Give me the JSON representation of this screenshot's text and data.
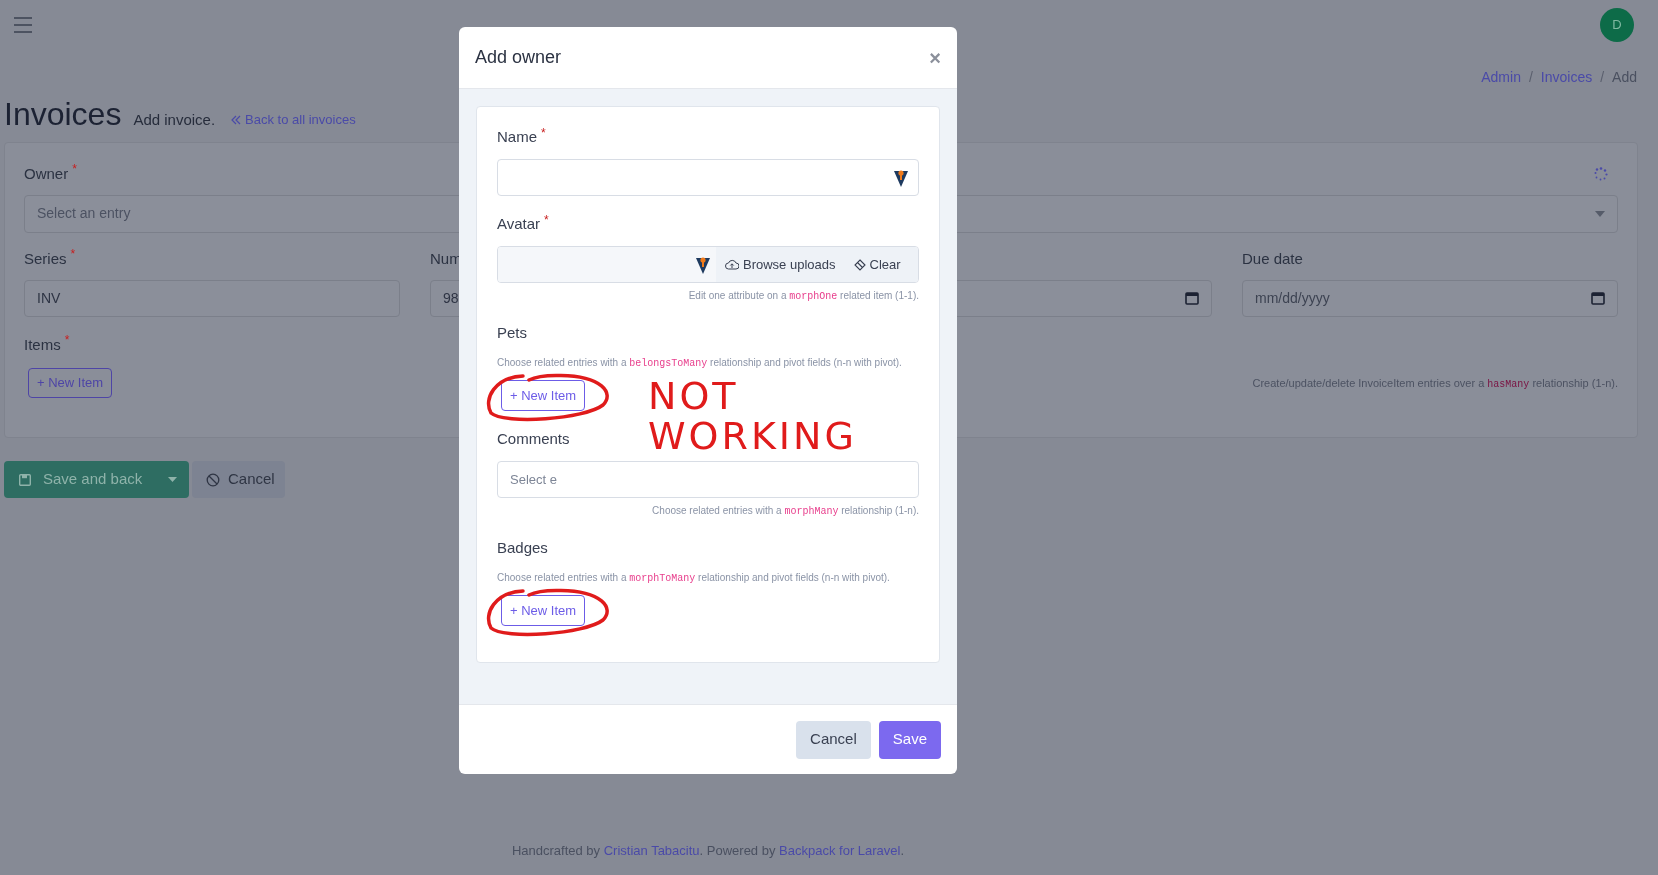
{
  "header": {
    "avatar": "D"
  },
  "breadcrumb": {
    "separator": "/",
    "items": [
      {
        "label": "Admin",
        "link": true
      },
      {
        "label": "Invoices",
        "link": true
      },
      {
        "label": "Add",
        "link": false
      }
    ]
  },
  "page": {
    "title": "Invoices",
    "subtitle": "Add invoice.",
    "back_link": "Back to all invoices"
  },
  "form": {
    "owner": {
      "label": "Owner",
      "mark": "*",
      "placeholder": "Select an entry"
    },
    "fields": [
      {
        "kind": "text",
        "label": "Series",
        "mark": "*",
        "value": "INV"
      },
      {
        "kind": "text",
        "label": "Num",
        "value": "98"
      },
      {
        "kind": "date"
      },
      {
        "kind": "date",
        "label": "Due date",
        "placeholder": "mm/dd/yyyy"
      }
    ],
    "items": {
      "label": "Items",
      "mark": "*",
      "button": "+ New Item",
      "help": {
        "before": "Create/update/delete InvoiceItem entries over a ",
        "code": "hasMany",
        "after": " relationship (1-n)."
      }
    }
  },
  "actions": [
    {
      "kind": "primary",
      "label": "Save and back"
    },
    {
      "kind": "secondary",
      "label": "Cancel"
    }
  ],
  "footer": [
    {
      "text": "Handcrafted by ",
      "link": false
    },
    {
      "text": "Cristian Tabacitu",
      "link": true
    },
    {
      "text": ". Powered by ",
      "link": false
    },
    {
      "text": "Backpack for Laravel",
      "link": true
    },
    {
      "text": ".",
      "link": false
    }
  ],
  "modal": {
    "title": "Add owner",
    "close": "×",
    "fields": [
      {
        "kind": "text",
        "label": "Name",
        "mark": "*"
      },
      {
        "kind": "upload",
        "label": "Avatar",
        "mark": "*",
        "buttons": [
          "Browse uploads",
          "Clear"
        ],
        "help": {
          "before": "Edit one attribute on a ",
          "code": "morphOne",
          "after": " related item (1-1)."
        }
      },
      {
        "kind": "repeatable",
        "label": "Pets",
        "help": {
          "before": "Choose related entries with a ",
          "code": "belongsToMany",
          "after": " relationship and pivot fields (n-n with pivot)."
        },
        "button": "+ New Item",
        "circled": true
      },
      {
        "kind": "select",
        "label": "Comments",
        "placeholder": "Select e",
        "help": {
          "before": "Choose related entries with a ",
          "code": "morphMany",
          "after": " relationship (1-n)."
        }
      },
      {
        "kind": "repeatable",
        "label": "Badges",
        "help": {
          "before": "Choose related entries with a ",
          "code": "morphToMany",
          "after": " relationship and pivot fields (n-n with pivot)."
        },
        "button": "+ New Item",
        "circled": true
      }
    ],
    "buttons": [
      {
        "kind": "secondary",
        "label": "Cancel"
      },
      {
        "kind": "primary",
        "label": "Save"
      }
    ]
  },
  "annotation": {
    "text": "NOT WORKING"
  }
}
